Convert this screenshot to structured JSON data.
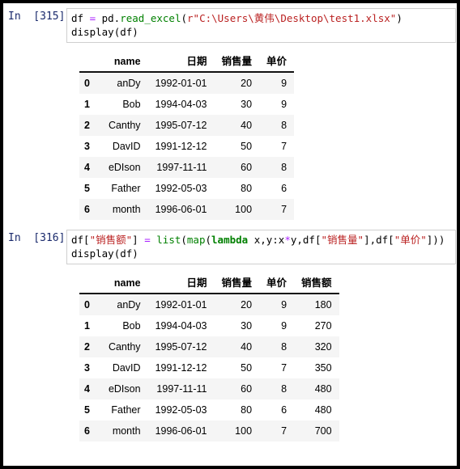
{
  "notebook": {
    "cells": [
      {
        "prompt_label": "In  [315]:",
        "code": {
          "line1": {
            "t1": "df ",
            "op1": "=",
            "t2": " pd.",
            "fn1": "read_excel",
            "t3": "(",
            "str1": "r\"C:\\Users\\黄伟\\Desktop\\test1.xlsx\"",
            "t4": ")"
          },
          "line2": {
            "fn1": "display",
            "t1": "(df)"
          }
        },
        "table": {
          "columns": [
            "",
            "name",
            "日期",
            "销售量",
            "单价"
          ],
          "rows": [
            [
              "0",
              "anDy",
              "1992-01-01",
              "20",
              "9"
            ],
            [
              "1",
              "Bob",
              "1994-04-03",
              "30",
              "9"
            ],
            [
              "2",
              "Canthy",
              "1995-07-12",
              "40",
              "8"
            ],
            [
              "3",
              "DavID",
              "1991-12-12",
              "50",
              "7"
            ],
            [
              "4",
              "eDIson",
              "1997-11-11",
              "60",
              "8"
            ],
            [
              "5",
              "Father",
              "1992-05-03",
              "80",
              "6"
            ],
            [
              "6",
              "month",
              "1996-06-01",
              "100",
              "7"
            ]
          ]
        }
      },
      {
        "prompt_label": "In  [316]:",
        "code": {
          "line1": {
            "t1": "df[",
            "str1": "\"销售额\"",
            "t2": "] ",
            "op1": "=",
            "t3": " ",
            "fn1": "list",
            "t4": "(",
            "fn2": "map",
            "t5": "(",
            "kw1": "lambda",
            "t6": " x,y:x",
            "op2": "*",
            "t7": "y,df[",
            "str2": "\"销售量\"",
            "t8": "],df[",
            "str3": "\"单价\"",
            "t9": "]))"
          },
          "line2": {
            "fn1": "display",
            "t1": "(df)"
          }
        },
        "table": {
          "columns": [
            "",
            "name",
            "日期",
            "销售量",
            "单价",
            "销售额"
          ],
          "rows": [
            [
              "0",
              "anDy",
              "1992-01-01",
              "20",
              "9",
              "180"
            ],
            [
              "1",
              "Bob",
              "1994-04-03",
              "30",
              "9",
              "270"
            ],
            [
              "2",
              "Canthy",
              "1995-07-12",
              "40",
              "8",
              "320"
            ],
            [
              "3",
              "DavID",
              "1991-12-12",
              "50",
              "7",
              "350"
            ],
            [
              "4",
              "eDIson",
              "1997-11-11",
              "60",
              "8",
              "480"
            ],
            [
              "5",
              "Father",
              "1992-05-03",
              "80",
              "6",
              "480"
            ],
            [
              "6",
              "month",
              "1996-06-01",
              "100",
              "7",
              "700"
            ]
          ]
        }
      }
    ]
  },
  "colors": {
    "prompt": "#1a2a6c",
    "string": "#ba2121",
    "function": "#008000",
    "keyword": "#008000",
    "operator": "#aa22ff",
    "cell_border": "#cfcfcf",
    "row_stripe": "#f5f5f5",
    "header_rule": "#111111",
    "page_border": "#000000"
  }
}
